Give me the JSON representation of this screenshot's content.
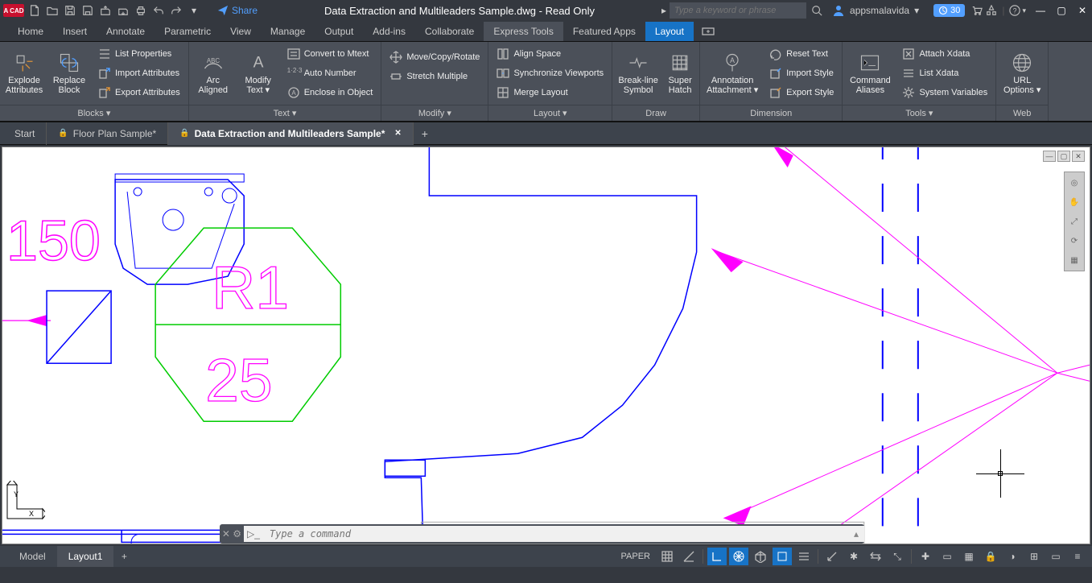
{
  "app": {
    "logo": "A CAD",
    "title": "Data Extraction and Multileaders Sample.dwg - Read Only"
  },
  "qat": {
    "share": "Share"
  },
  "search": {
    "placeholder": "Type a keyword or phrase"
  },
  "user": {
    "name": "appsmalavida",
    "trial": "30"
  },
  "ribbon": {
    "tabs": [
      "Home",
      "Insert",
      "Annotate",
      "Parametric",
      "View",
      "Manage",
      "Output",
      "Add-ins",
      "Collaborate",
      "Express Tools",
      "Featured Apps",
      "Layout"
    ],
    "active": "Layout",
    "panels": {
      "blocks": {
        "title": "Blocks ▾",
        "big": [
          {
            "l1": "Explode",
            "l2": "Attributes"
          },
          {
            "l1": "Replace",
            "l2": "Block"
          }
        ],
        "small": [
          "List Properties",
          "Import Attributes",
          "Export Attributes"
        ]
      },
      "text": {
        "title": "Text ▾",
        "big": [
          {
            "l1": "Arc",
            "l2": "Aligned"
          },
          {
            "l1": "Modify",
            "l2": "Text ▾"
          }
        ],
        "small": [
          "Convert to Mtext",
          "Auto Number",
          "Enclose in Object"
        ]
      },
      "modify": {
        "title": "Modify ▾",
        "small": [
          "Move/Copy/Rotate",
          "Stretch Multiple"
        ]
      },
      "layout": {
        "title": "Layout ▾",
        "small": [
          "Align Space",
          "Synchronize Viewports",
          "Merge Layout"
        ]
      },
      "draw": {
        "title": "Draw",
        "big": [
          {
            "l1": "Break-line",
            "l2": "Symbol"
          },
          {
            "l1": "Super",
            "l2": "Hatch"
          }
        ]
      },
      "dimension": {
        "title": "Dimension",
        "big": [
          {
            "l1": "Annotation",
            "l2": "Attachment ▾"
          }
        ],
        "small": [
          "Reset Text",
          "Import Style",
          "Export Style"
        ]
      },
      "tools": {
        "title": "Tools ▾",
        "big": [
          {
            "l1": "Command",
            "l2": "Aliases"
          }
        ],
        "small": [
          "Attach Xdata",
          "List Xdata",
          "System Variables"
        ]
      },
      "web": {
        "title": "Web",
        "big": [
          {
            "l1": "URL",
            "l2": "Options ▾"
          }
        ]
      }
    }
  },
  "docs": {
    "tabs": [
      {
        "label": "Start",
        "lock": false,
        "close": false
      },
      {
        "label": "Floor Plan Sample*",
        "lock": true,
        "close": false
      },
      {
        "label": "Data Extraction and Multileaders Sample*",
        "lock": true,
        "close": true,
        "active": true
      }
    ]
  },
  "layout_tabs": {
    "tabs": [
      "Model",
      "Layout1"
    ],
    "active": "Layout1"
  },
  "cmdline": {
    "placeholder": "Type a command"
  },
  "status": {
    "paper": "PAPER"
  },
  "drawing": {
    "dim_text": "150",
    "room_label_top": "R1",
    "room_label_bottom": "25"
  }
}
